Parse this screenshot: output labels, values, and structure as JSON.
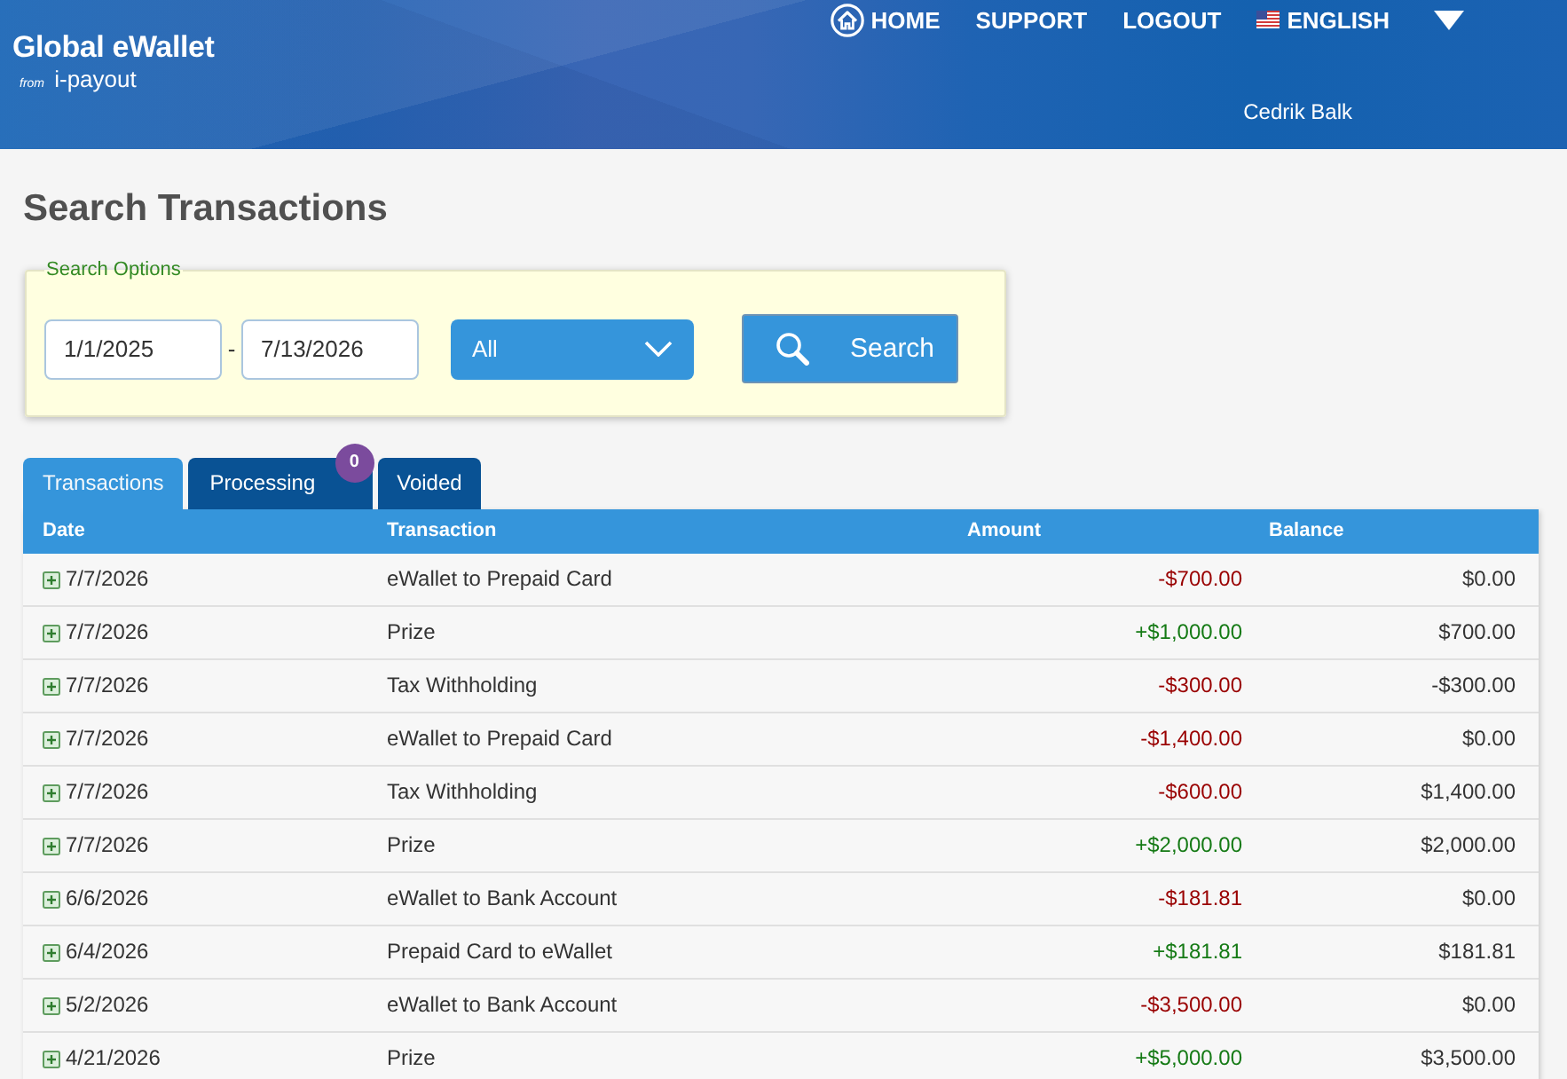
{
  "header": {
    "logo": {
      "title": "Global eWallet",
      "subtitle": "*from* i-payout"
    },
    "nav": [
      {
        "kind": "home",
        "label": "HOME"
      },
      {
        "kind": "link",
        "label": "SUPPORT"
      },
      {
        "kind": "link",
        "label": "LOGOUT"
      },
      {
        "kind": "language",
        "label": "ENGLISH"
      }
    ],
    "user_name": "Cedrik Balk"
  },
  "page_title": "Search Transactions",
  "search_options": {
    "legend": "Search Options",
    "start_date": "1/1/2025",
    "separator": "-",
    "end_date": "7/13/2026",
    "type": "All",
    "button": "Search"
  },
  "tabs": [
    {
      "label": "Transactions",
      "selected": true
    },
    {
      "label": "Processing",
      "selected": false,
      "badge": "0"
    },
    {
      "label": "Voided",
      "selected": false
    }
  ],
  "table": {
    "columns": [
      "Date",
      "Transaction",
      "Amount",
      "Balance"
    ],
    "rows": [
      {
        "date": "7/7/2026",
        "transaction": "eWallet to Prepaid Card",
        "amount": "-$700.00",
        "balance": "$0.00",
        "color": "#990000",
        "expanded": false
      },
      {
        "date": "7/7/2026",
        "transaction": "Prize",
        "amount": "+$1,000.00",
        "balance": "$700.00",
        "color": "#157a15",
        "expanded": false
      },
      {
        "date": "7/7/2026",
        "transaction": "Tax Withholding",
        "amount": "-$300.00",
        "balance": "-$300.00",
        "color": "#990000",
        "expanded": false
      },
      {
        "date": "7/7/2026",
        "transaction": "eWallet to Prepaid Card",
        "amount": "-$1,400.00",
        "balance": "$0.00",
        "color": "#990000",
        "expanded": false
      },
      {
        "date": "7/7/2026",
        "transaction": "Tax Withholding",
        "amount": "-$600.00",
        "balance": "$1,400.00",
        "color": "#990000",
        "expanded": false
      },
      {
        "date": "7/7/2026",
        "transaction": "Prize",
        "amount": "+$2,000.00",
        "balance": "$2,000.00",
        "color": "#157a15",
        "expanded": false
      },
      {
        "date": "6/6/2026",
        "transaction": "eWallet to Bank Account",
        "amount": "-$181.81",
        "balance": "$0.00",
        "color": "#990000",
        "expanded": false
      },
      {
        "date": "6/4/2026",
        "transaction": "Prepaid Card to eWallet",
        "amount": "+$181.81",
        "balance": "$181.81",
        "color": "#157a15",
        "expanded": false
      },
      {
        "date": "5/2/2026",
        "transaction": "eWallet to Bank Account",
        "amount": "-$3,500.00",
        "balance": "$0.00",
        "color": "#990000",
        "expanded": false
      },
      {
        "date": "4/21/2026",
        "transaction": "Prize",
        "amount": "+$5,000.00",
        "balance": "$3,500.00",
        "color": "#157a15",
        "expanded": false
      }
    ]
  }
}
